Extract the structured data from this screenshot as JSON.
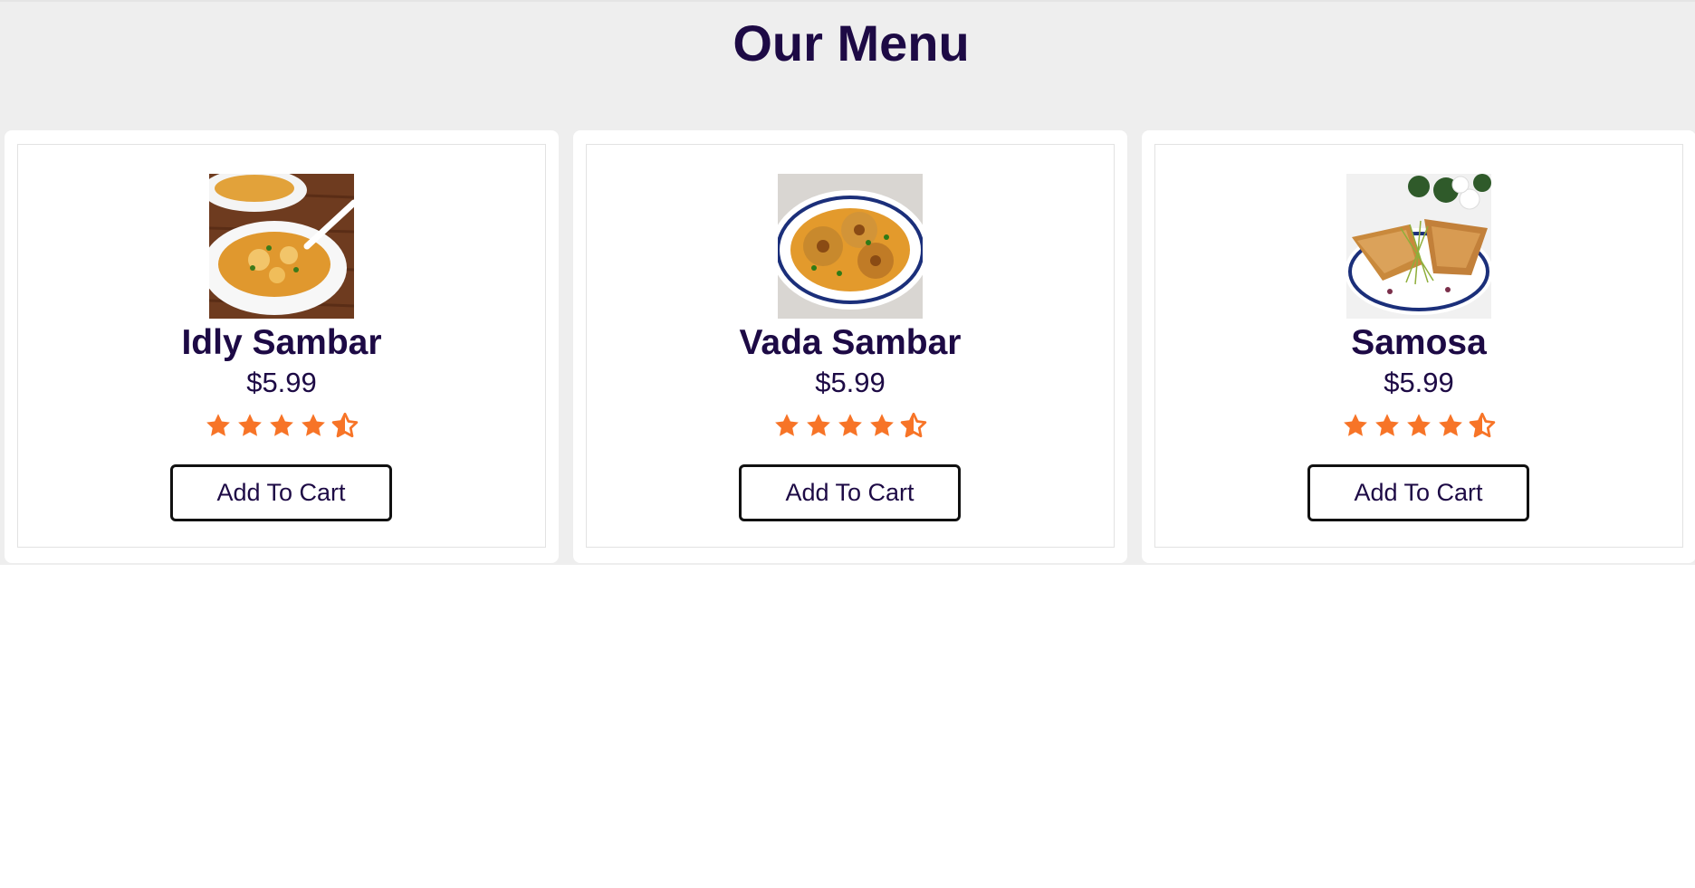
{
  "menu": {
    "title": "Our Menu"
  },
  "items": [
    {
      "name": "Idly Sambar",
      "price": "$5.99",
      "rating": 4.5,
      "button_label": "Add To Cart",
      "image_icon": "idly-sambar-photo"
    },
    {
      "name": "Vada Sambar",
      "price": "$5.99",
      "rating": 4.5,
      "button_label": "Add To Cart",
      "image_icon": "vada-sambar-photo"
    },
    {
      "name": "Samosa",
      "price": "$5.99",
      "rating": 4.5,
      "button_label": "Add To Cart",
      "image_icon": "samosa-photo"
    }
  ],
  "colors": {
    "heading": "#1d0a45",
    "star": "#f77427",
    "page_background": "#eeeeee",
    "card_background": "#ffffff"
  }
}
